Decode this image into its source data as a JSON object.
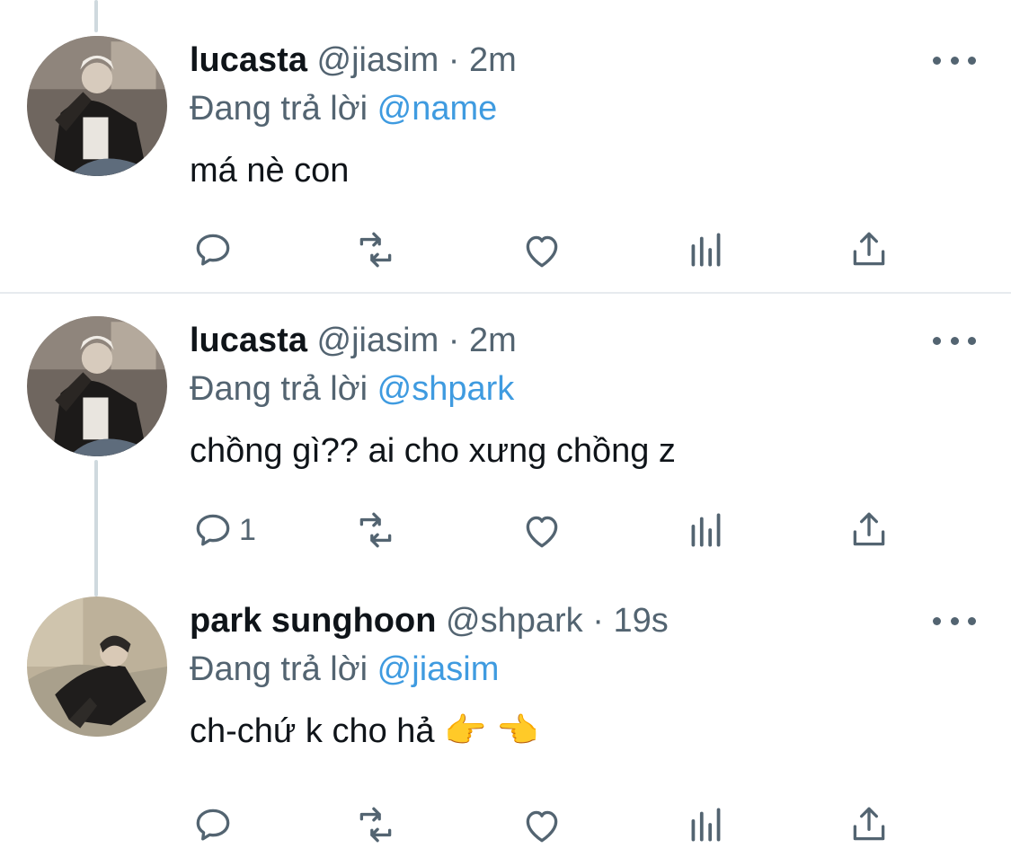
{
  "tweets": [
    {
      "display_name": "lucasta",
      "handle": "@jiasim",
      "separator": "·",
      "time": "2m",
      "replying_prefix": "Đang trả lời",
      "replying_to": "@name",
      "text": "má nè con",
      "reply_count": "",
      "avatar_icon": "avatar-photo"
    },
    {
      "display_name": "lucasta",
      "handle": "@jiasim",
      "separator": "·",
      "time": "2m",
      "replying_prefix": "Đang trả lời",
      "replying_to": "@shpark",
      "text": "chồng gì?? ai cho xưng chồng z",
      "reply_count": "1",
      "avatar_icon": "avatar-photo"
    },
    {
      "display_name": "park sunghoon",
      "handle": "@shpark",
      "separator": "·",
      "time": "19s",
      "replying_prefix": "Đang trả lời",
      "replying_to": "@jiasim",
      "text": "ch-chứ k cho hả 👉 👈",
      "reply_count": "",
      "avatar_icon": "avatar-photo"
    }
  ],
  "icons": {
    "reply": "reply-icon",
    "retweet": "retweet-icon",
    "like": "heart-icon",
    "analytics": "analytics-icon",
    "share": "share-icon",
    "more": "more-icon"
  },
  "colors": {
    "text": "#0f1419",
    "muted": "#536471",
    "mention": "#3f9be0",
    "divider": "#e7ebee",
    "thread_line": "#cfd9de"
  }
}
